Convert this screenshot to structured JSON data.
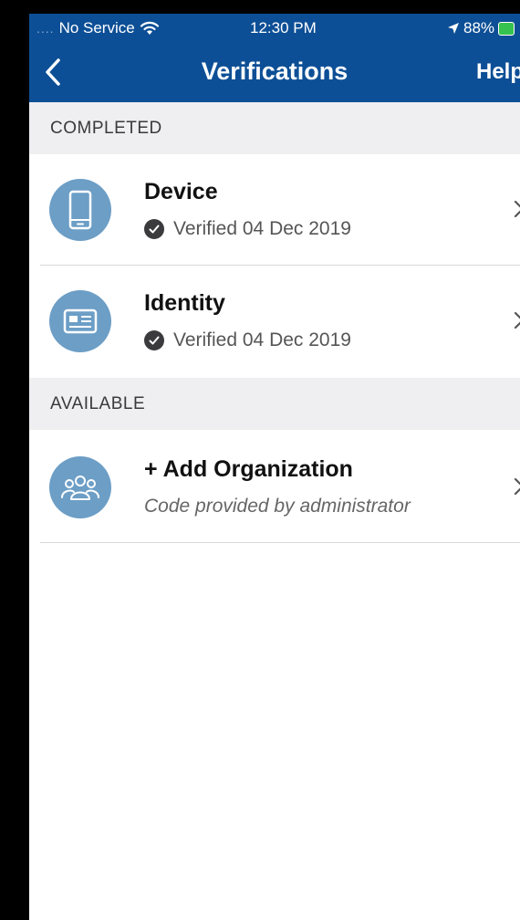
{
  "status_bar": {
    "signal": "....",
    "carrier": "No Service",
    "time": "12:30 PM",
    "battery": "88%"
  },
  "nav": {
    "title": "Verifications",
    "help": "Help"
  },
  "sections": {
    "completed": {
      "label": "COMPLETED",
      "items": [
        {
          "title": "Device",
          "status": "Verified 04 Dec 2019",
          "icon": "phone-icon"
        },
        {
          "title": "Identity",
          "status": "Verified 04 Dec 2019",
          "icon": "id-card-icon"
        }
      ]
    },
    "available": {
      "label": "AVAILABLE",
      "items": [
        {
          "title": "+ Add Organization",
          "subtitle": "Code provided by administrator",
          "icon": "group-icon"
        }
      ]
    }
  },
  "colors": {
    "brand": "#0d4f96",
    "icon_bg": "#6c9ec6",
    "section_bg": "#efeff1"
  }
}
